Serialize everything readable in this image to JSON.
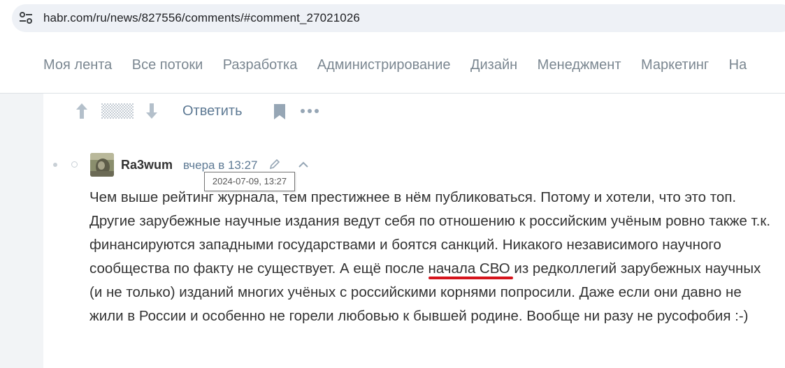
{
  "browser": {
    "url": "habr.com/ru/news/827556/comments/#comment_27021026",
    "site_icon": "tune-icon"
  },
  "nav": {
    "items": [
      {
        "label": "Моя лента"
      },
      {
        "label": "Все потоки"
      },
      {
        "label": "Разработка"
      },
      {
        "label": "Администрирование"
      },
      {
        "label": "Дизайн"
      },
      {
        "label": "Менеджмент"
      },
      {
        "label": "Маркетинг"
      },
      {
        "label": "На"
      }
    ]
  },
  "actions": {
    "reply_label": "Ответить"
  },
  "comment": {
    "username": "Ra3wum",
    "time": "вчера в 13:27",
    "tooltip": "2024-07-09, 13:27",
    "text_before": "Чем выше рейтинг журнала, тем престижнее в нём публиковаться. Потому и хотели, что это топ. Другие зарубежные научные издания ведут себя по отношению к российским учёным ровно также т.к. финансируются западными государствами и боятся санкций. Никакого независимого научного сообщества по факту не существует. А ещё после ",
    "text_highlight": "начала СВО",
    "text_after": " из редколлегий зарубежных научных (и не только) изданий многих учёных с российскими корнями попросили. Даже если они давно не жили в России и особенно не горели любовью к бывшей родине. Вообще ни разу не русофобия :-)",
    "highlight_color": "#d6141c"
  }
}
